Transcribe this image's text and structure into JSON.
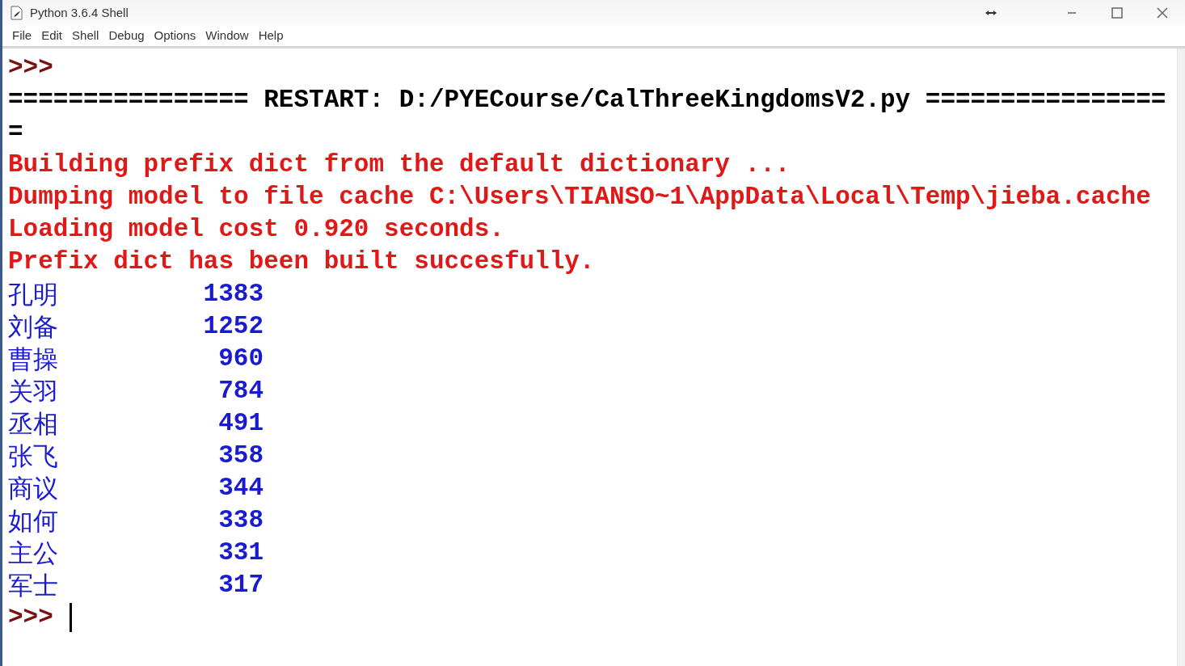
{
  "window": {
    "title": "Python 3.6.4 Shell"
  },
  "menu": [
    "File",
    "Edit",
    "Shell",
    "Debug",
    "Options",
    "Window",
    "Help"
  ],
  "lines": [
    {
      "kind": "prompt",
      "text": ">>>"
    },
    {
      "kind": "plain",
      "text": "================ RESTART: D:/PYECourse/CalThreeKingdomsV2.py ================"
    },
    {
      "kind": "plain",
      "text": "="
    },
    {
      "kind": "error",
      "text": "Building prefix dict from the default dictionary ..."
    },
    {
      "kind": "error",
      "text": "Dumping model to file cache C:\\Users\\TIANSO~1\\AppData\\Local\\Temp\\jieba.cache"
    },
    {
      "kind": "error",
      "text": "Loading model cost 0.920 seconds."
    },
    {
      "kind": "error",
      "text": "Prefix dict has been built succesfully."
    },
    {
      "kind": "result",
      "name": "孔明",
      "count": "1383"
    },
    {
      "kind": "result",
      "name": "刘备",
      "count": "1252"
    },
    {
      "kind": "result",
      "name": "曹操",
      "count": "960"
    },
    {
      "kind": "result",
      "name": "关羽",
      "count": "784"
    },
    {
      "kind": "result",
      "name": "丞相",
      "count": "491"
    },
    {
      "kind": "result",
      "name": "张飞",
      "count": "358"
    },
    {
      "kind": "result",
      "name": "商议",
      "count": "344"
    },
    {
      "kind": "result",
      "name": "如何",
      "count": "338"
    },
    {
      "kind": "result",
      "name": "主公",
      "count": "331"
    },
    {
      "kind": "result",
      "name": "军士",
      "count": "317"
    },
    {
      "kind": "input_prompt",
      "text": ">>>"
    }
  ]
}
